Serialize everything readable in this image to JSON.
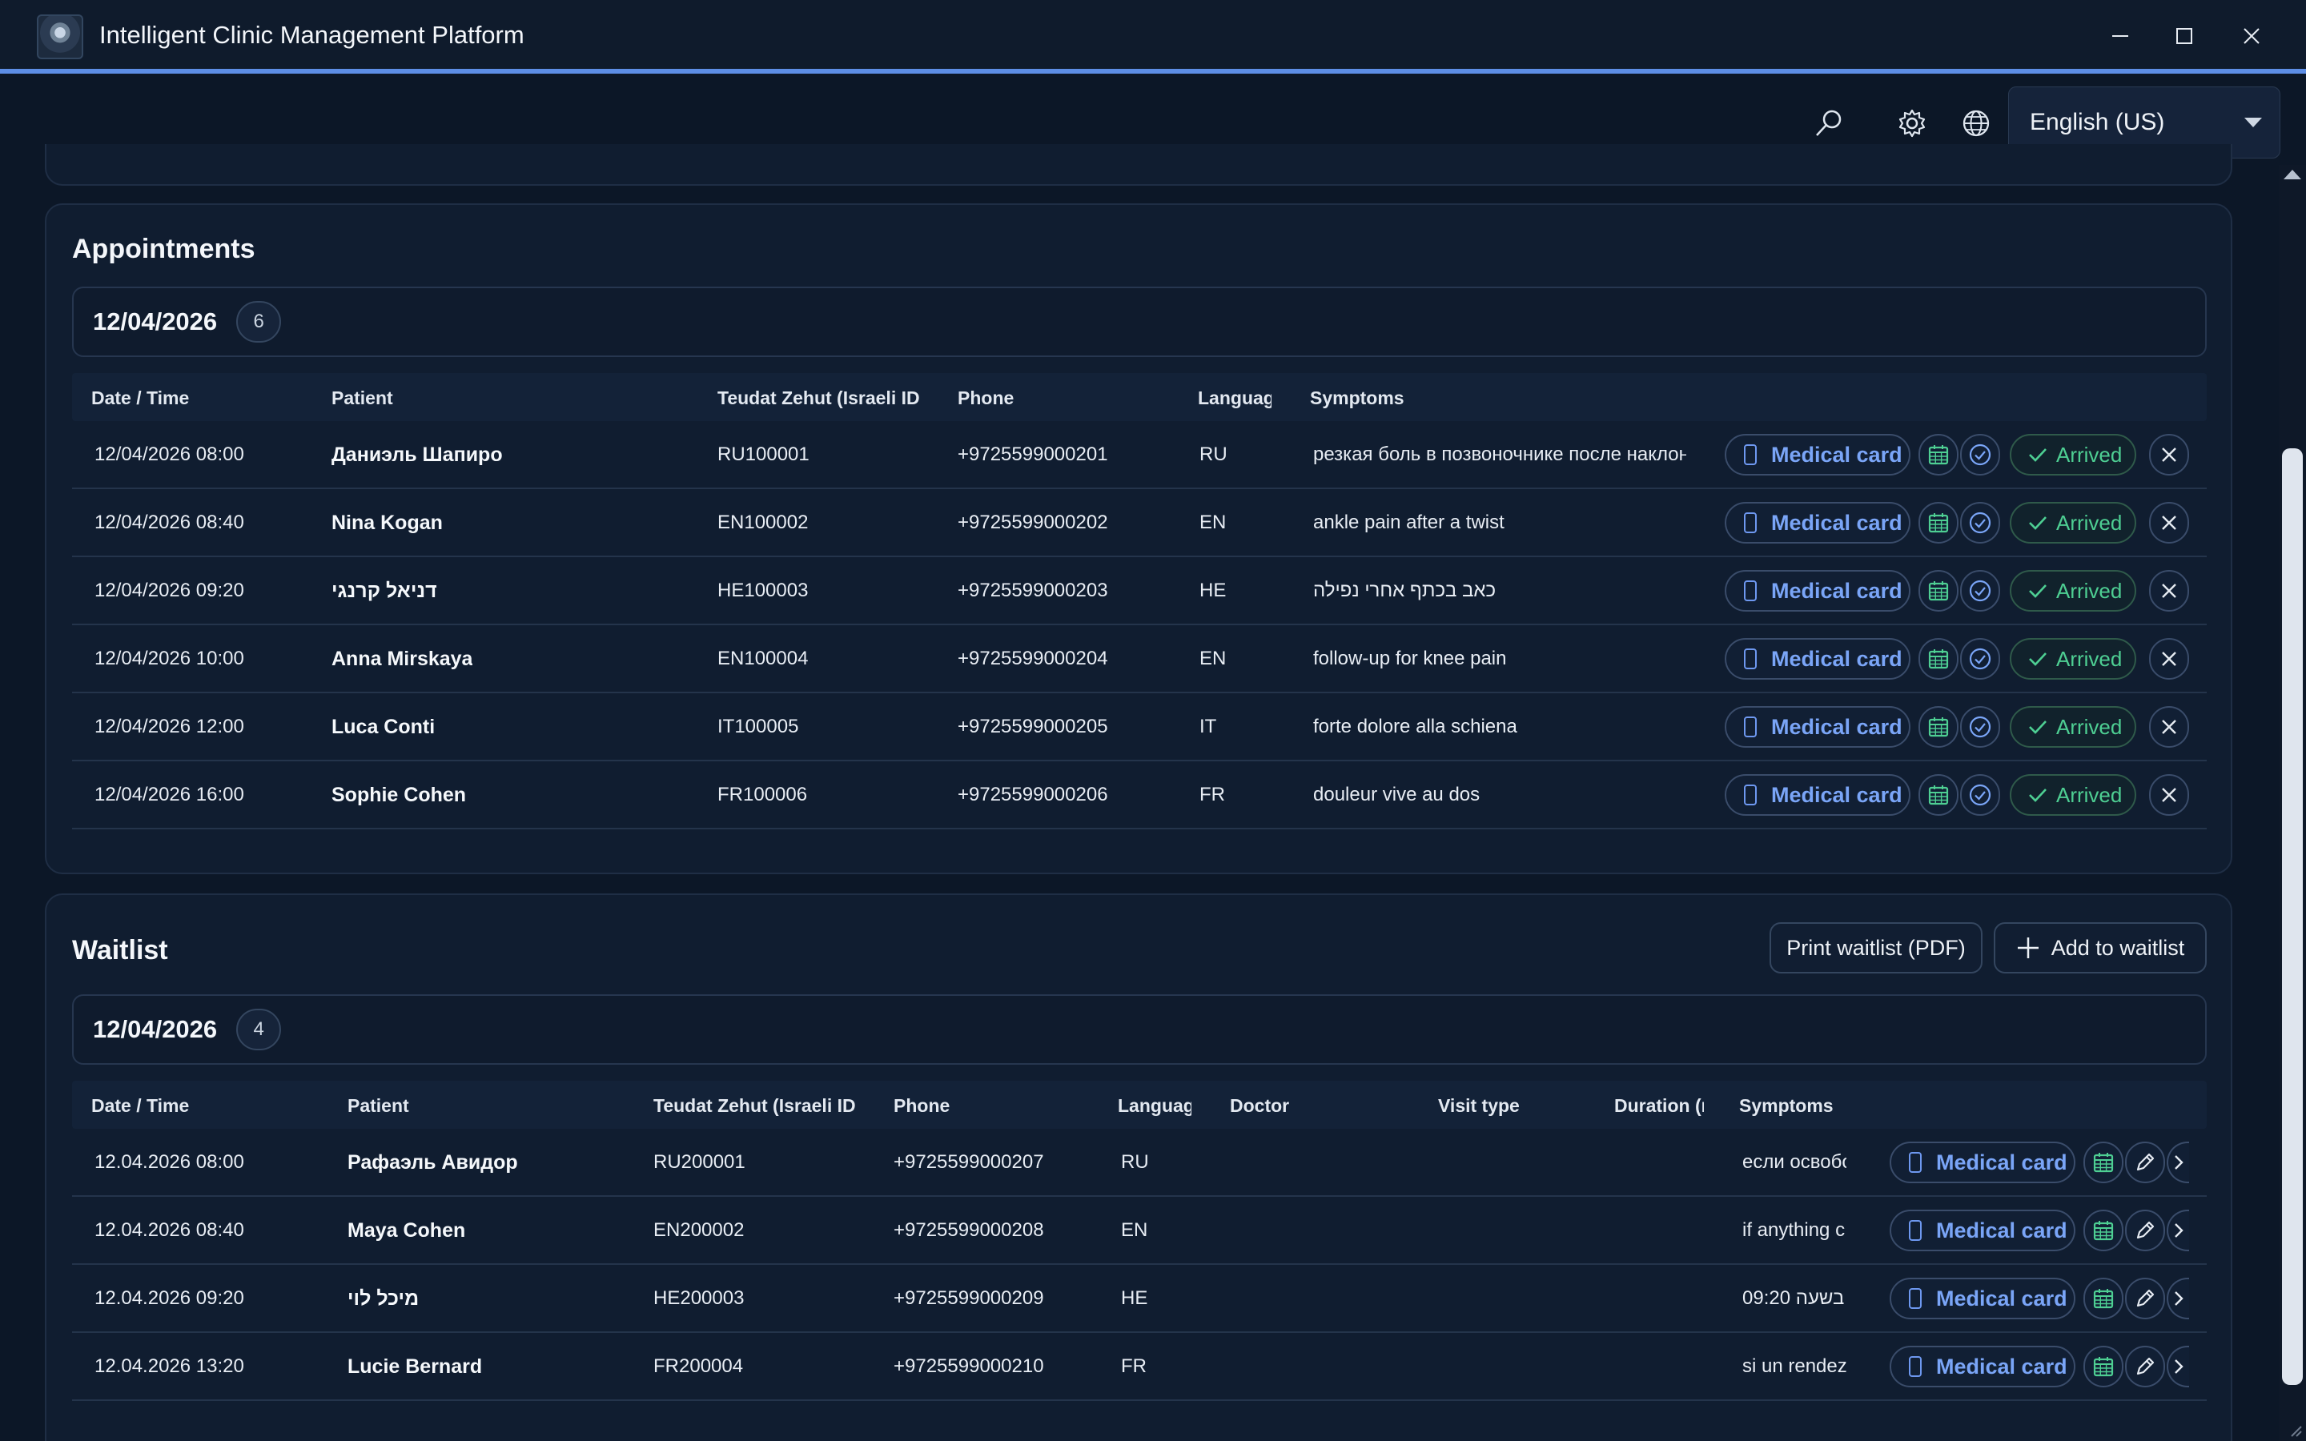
{
  "app": {
    "title": "Intelligent Clinic Management Platform"
  },
  "toolbar": {
    "language_value": "English (US)"
  },
  "appointments": {
    "title": "Appointments",
    "date": "12/04/2026",
    "count": "6",
    "columns": [
      "Date / Time",
      "Patient",
      "Teudat Zehut (Israeli ID n",
      "Phone",
      "Language",
      "Symptoms"
    ],
    "medical_card_label": "Medical card",
    "arrived_label": "Arrived",
    "rows": [
      {
        "datetime": "12/04/2026 08:00",
        "patient": "Даниэль Шапиро",
        "id": "RU100001",
        "phone": "+9725599000201",
        "language": "RU",
        "symptoms": "резкая боль в позвоночнике после наклона"
      },
      {
        "datetime": "12/04/2026 08:40",
        "patient": "Nina Kogan",
        "id": "EN100002",
        "phone": "+9725599000202",
        "language": "EN",
        "symptoms": "ankle pain after a twist"
      },
      {
        "datetime": "12/04/2026 09:20",
        "patient": "דניאל קרנגי",
        "id": "HE100003",
        "phone": "+9725599000203",
        "language": "HE",
        "symptoms": "כאב בכתף אחרי נפילה"
      },
      {
        "datetime": "12/04/2026 10:00",
        "patient": "Anna Mirskaya",
        "id": "EN100004",
        "phone": "+9725599000204",
        "language": "EN",
        "symptoms": "follow-up for knee pain"
      },
      {
        "datetime": "12/04/2026 12:00",
        "patient": "Luca Conti",
        "id": "IT100005",
        "phone": "+9725599000205",
        "language": "IT",
        "symptoms": "forte dolore alla schiena"
      },
      {
        "datetime": "12/04/2026 16:00",
        "patient": "Sophie Cohen",
        "id": "FR100006",
        "phone": "+9725599000206",
        "language": "FR",
        "symptoms": "douleur vive au dos"
      }
    ]
  },
  "waitlist": {
    "title": "Waitlist",
    "print_label": "Print waitlist (PDF)",
    "add_label": "Add to waitlist",
    "date": "12/04/2026",
    "count": "4",
    "columns": [
      "Date / Time",
      "Patient",
      "Teudat Zehut (Israeli ID n",
      "Phone",
      "Language",
      "Doctor",
      "Visit type",
      "Duration (n",
      "Symptoms"
    ],
    "medical_card_label": "Medical card",
    "rows": [
      {
        "datetime": "12.04.2026 08:00",
        "patient": "Рафаэль Авидор",
        "id": "RU200001",
        "phone": "+9725599000207",
        "language": "RU",
        "symptoms": "если освобо"
      },
      {
        "datetime": "12.04.2026 08:40",
        "patient": "Maya Cohen",
        "id": "EN200002",
        "phone": "+9725599000208",
        "language": "EN",
        "symptoms": "if anything c"
      },
      {
        "datetime": "12.04.2026 09:20",
        "patient": "מיכל לוי",
        "id": "HE200003",
        "phone": "+9725599000209",
        "language": "HE",
        "symptoms": "09:20 בשעה"
      },
      {
        "datetime": "12.04.2026 13:20",
        "patient": "Lucie Bernard",
        "id": "FR200004",
        "phone": "+9725599000210",
        "language": "FR",
        "symptoms": "si un rendez"
      }
    ]
  },
  "colors": {
    "accent": "#5d8ee6",
    "medical_card_text": "#7aa5f7",
    "arrived_green": "#4ecf93",
    "background": "#0c1727"
  }
}
